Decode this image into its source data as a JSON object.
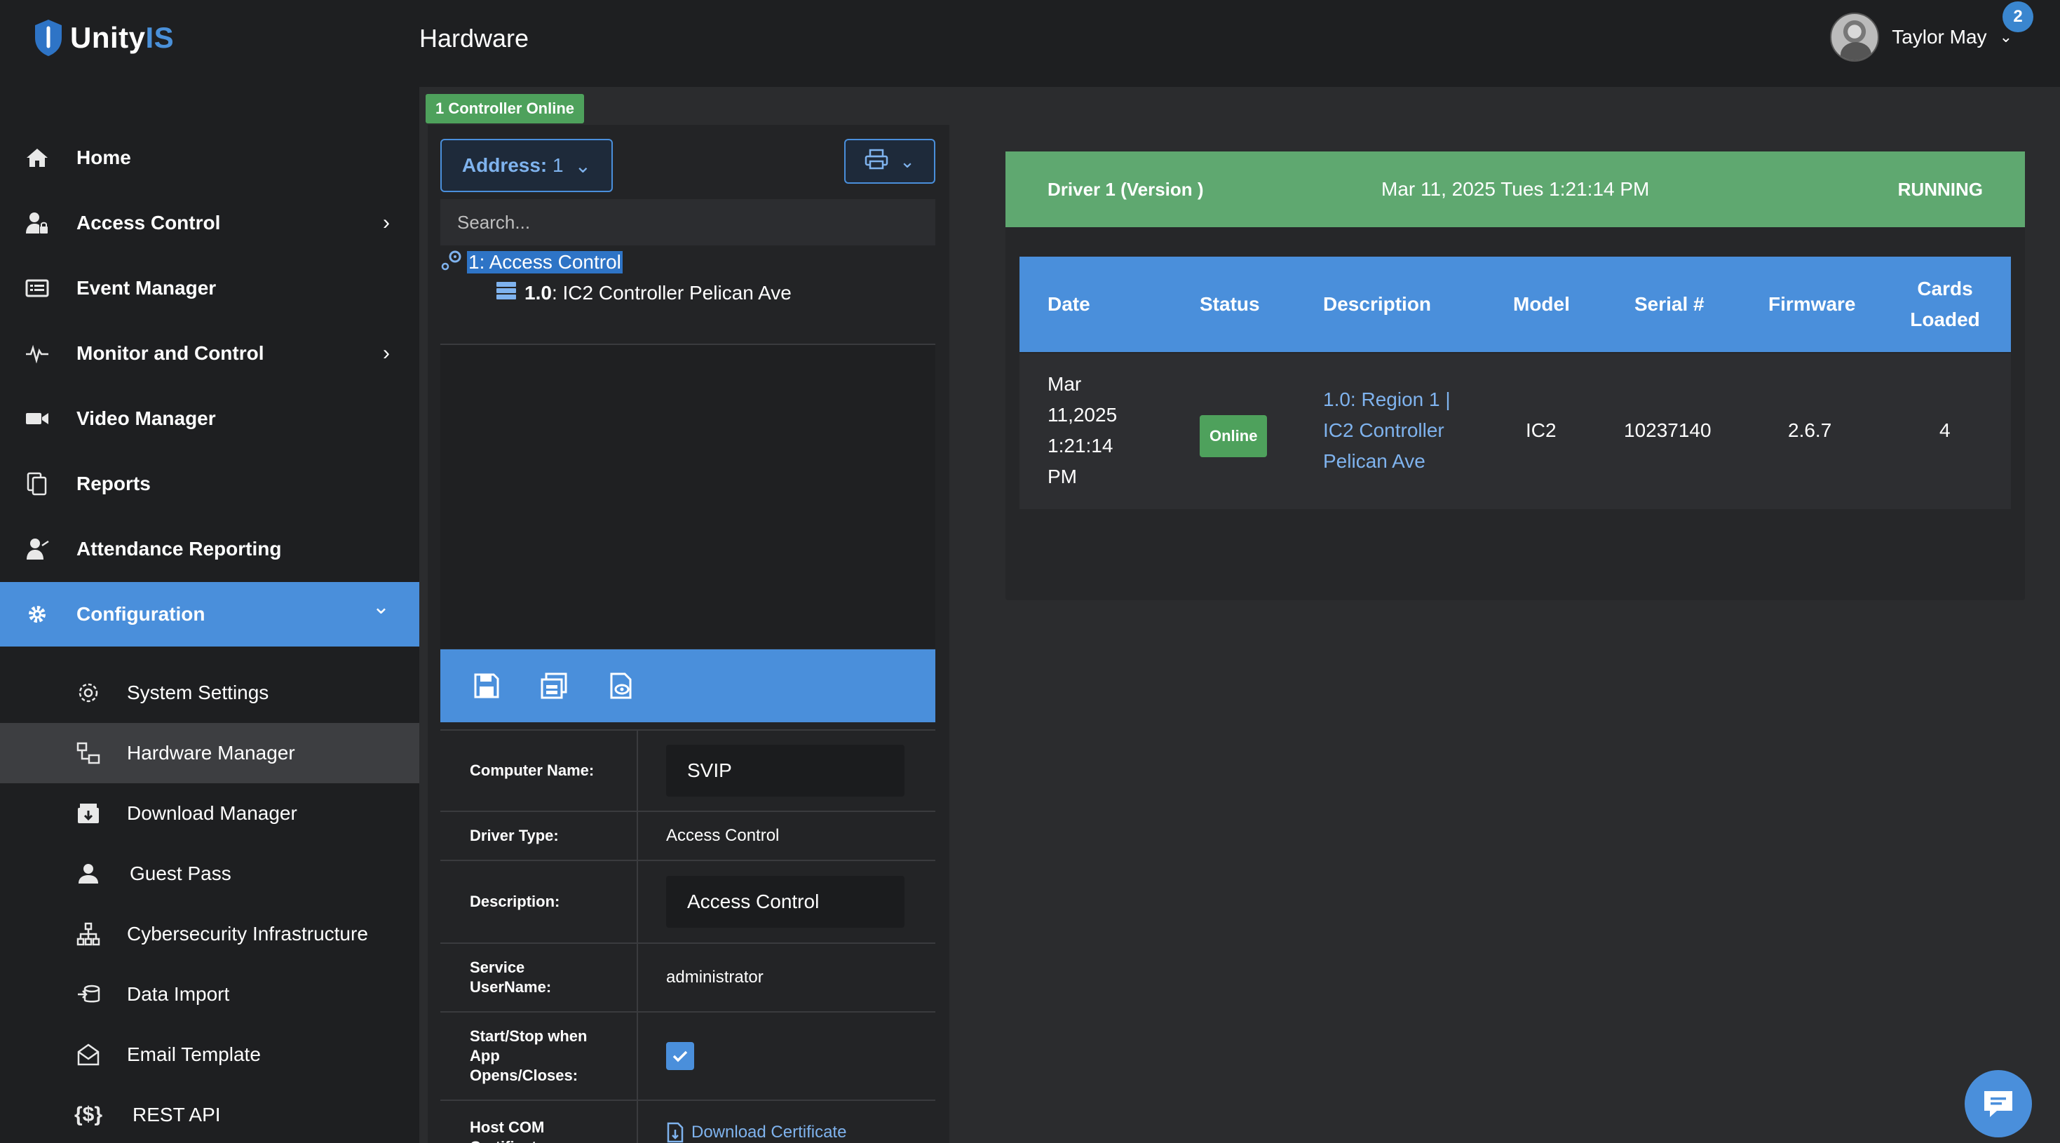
{
  "app": {
    "logo_text_a": "Unity",
    "logo_text_b": "IS"
  },
  "header": {
    "page_title": "Hardware",
    "user_name": "Taylor May",
    "notification_count": "2"
  },
  "sidebar": {
    "items": [
      {
        "label": "Home",
        "icon": "home-icon"
      },
      {
        "label": "Access Control",
        "icon": "user-lock-icon",
        "arrow": "›"
      },
      {
        "label": "Event Manager",
        "icon": "list-icon"
      },
      {
        "label": "Monitor and Control",
        "icon": "pulse-icon",
        "arrow": "›"
      },
      {
        "label": "Video Manager",
        "icon": "video-icon"
      },
      {
        "label": "Reports",
        "icon": "reports-icon"
      },
      {
        "label": "Attendance Reporting",
        "icon": "attendance-icon"
      },
      {
        "label": "Configuration",
        "icon": "gear-icon",
        "arrow": "⌄"
      }
    ],
    "subitems": [
      {
        "label": "System Settings"
      },
      {
        "label": "Hardware Manager"
      },
      {
        "label": "Download Manager"
      },
      {
        "label": "Guest Pass"
      },
      {
        "label": "Cybersecurity Infrastructure"
      },
      {
        "label": "Data Import"
      },
      {
        "label": "Email Template"
      },
      {
        "label": "REST API"
      }
    ]
  },
  "tree": {
    "online_badge": "1 Controller Online",
    "address_label": "Address:",
    "address_value": "1",
    "search_placeholder": "Search...",
    "root_label": "1: Access Control",
    "child_id": "1.0",
    "child_label": ": IC2 Controller Pelican Ave"
  },
  "form": {
    "computer_name_label": "Computer Name:",
    "computer_name_value": "SVIP",
    "driver_type_label": "Driver Type:",
    "driver_type_value": "Access Control",
    "description_label": "Description:",
    "description_value": "Access Control",
    "service_user_label": "Service UserName:",
    "service_user_value": "administrator",
    "startstop_label": "Start/Stop when App Opens/Closes:",
    "startstop_checked": true,
    "hostcom_label": "Host COM Certificate:",
    "download_cert": "Download Certificate"
  },
  "status": {
    "driver": "Driver 1 (Version )",
    "datetime": "Mar 11, 2025 Tues 1:21:14 PM",
    "state": "RUNNING",
    "bar_color": "#5fa870"
  },
  "table": {
    "headers": [
      "Date",
      "Status",
      "Description",
      "Model",
      "Serial #",
      "Firmware",
      "Cards Loaded"
    ],
    "rows": [
      {
        "date": "Mar 11,2025 1:21:14 PM",
        "status": "Online",
        "description": "1.0: Region 1 | IC2 Controller Pelican Ave",
        "model": "IC2",
        "serial": "10237140",
        "firmware": "2.6.7",
        "cards": "4"
      }
    ]
  },
  "colors": {
    "accent": "#4a8fdb",
    "online": "#4ea15c",
    "sidebar_bg": "#1e1f21"
  }
}
